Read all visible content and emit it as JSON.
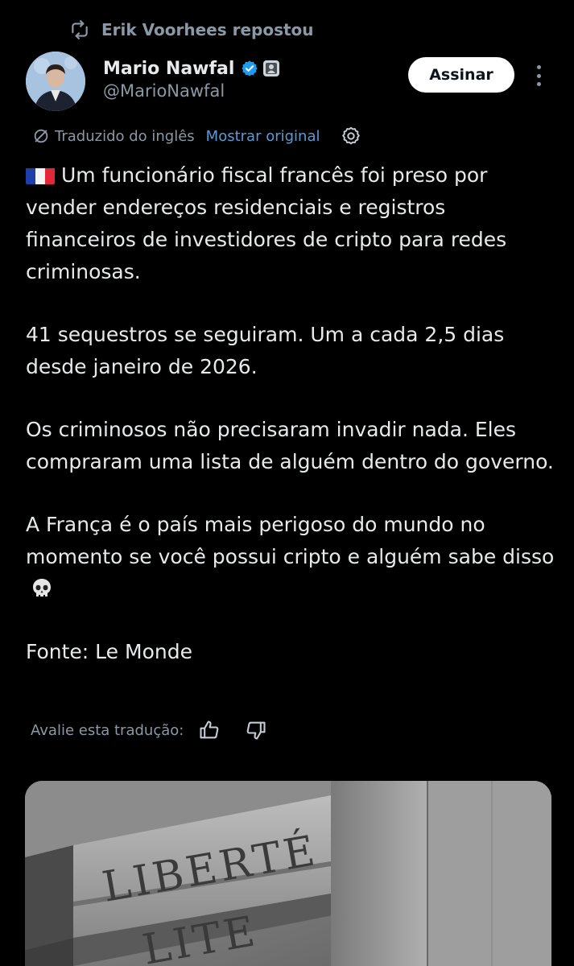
{
  "repost": {
    "label": "Erik Voorhees repostou",
    "icon": "repost-icon"
  },
  "author": {
    "name": "Mario Nawfal",
    "handle": "@MarioNawfal",
    "verified_icon": "verified-badge-icon",
    "affiliate_icon": "affiliate-badge-icon",
    "verified_color": "#1d9bf0"
  },
  "actions": {
    "subscribe_label": "Assinar",
    "more_icon": "more-options-icon"
  },
  "translation": {
    "translated_label": "Traduzido do inglês",
    "show_original_label": "Mostrar original",
    "link_color": "#5b9bd5",
    "rate_label": "Avalie esta tradução:",
    "thumbs_up_icon": "thumbs-up-icon",
    "thumbs_down_icon": "thumbs-down-icon",
    "settings_icon": "gear-icon"
  },
  "post": {
    "paragraph_1": "Um funcionário fiscal francês foi preso por vender endereços residenciais e registros financeiros de investidores de cripto para redes criminosas.",
    "paragraph_2": "41 sequestros se seguiram. Um a cada 2,5 dias desde janeiro de 2026.",
    "paragraph_3": "Os criminosos não precisaram invadir nada. Eles compraram uma lista de alguém dentro do governo.",
    "paragraph_4": "A França é o país mais perigoso do mundo no momento se você possui cripto e alguém sabe disso",
    "paragraph_5": "Fonte: Le Monde",
    "flag_icon": "france-flag-icon",
    "skull_icon": "skull-icon"
  },
  "media": {
    "inscription_line_1": "LIBERTÉ",
    "inscription_line_2": "LITE"
  }
}
